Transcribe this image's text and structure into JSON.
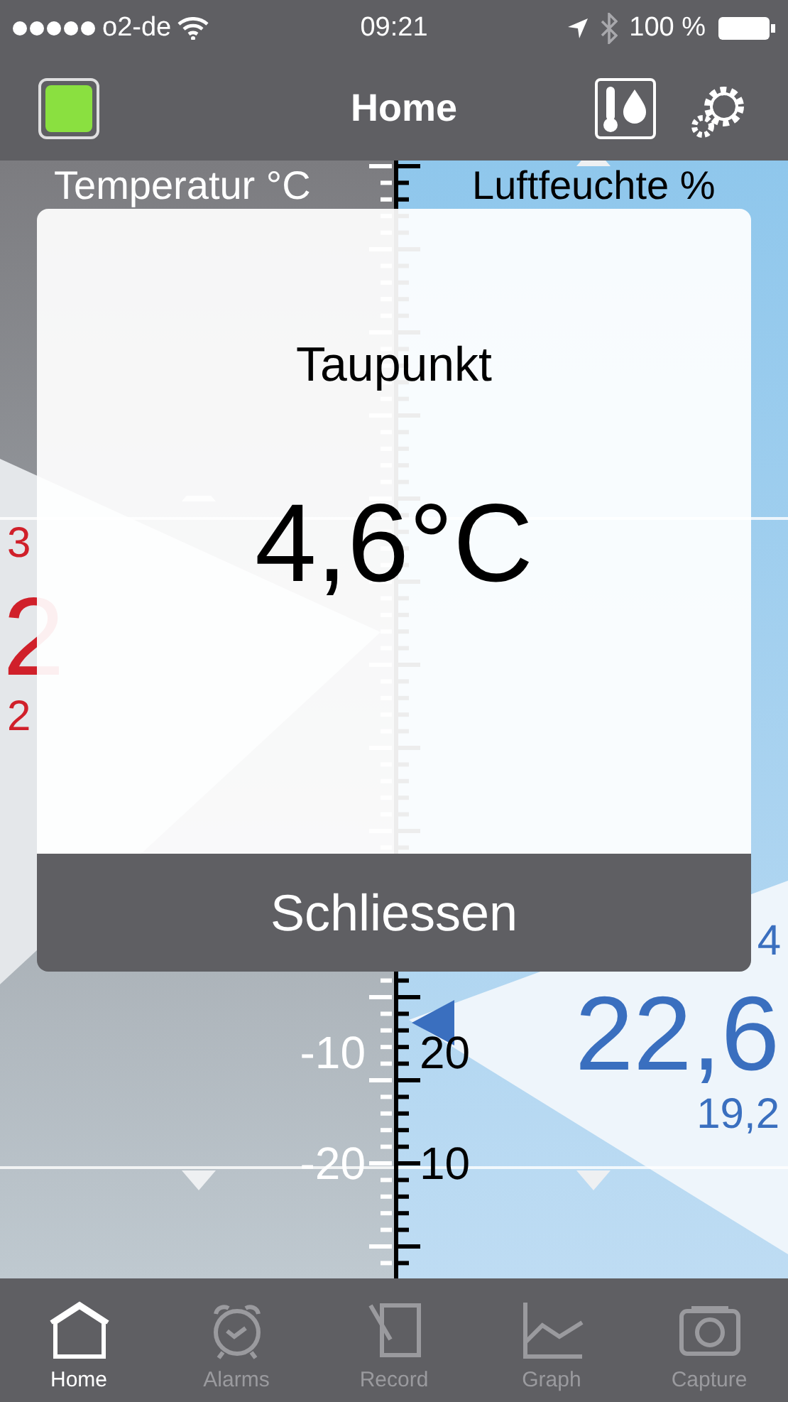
{
  "status_bar": {
    "carrier": "o2-de",
    "time": "09:21",
    "battery": "100 %"
  },
  "nav_bar": {
    "title": "Home"
  },
  "gauges": [
    {
      "kind": "temperature",
      "title": "Temperatur °C",
      "max": "3",
      "current": "2",
      "min": "2",
      "scale_labels": [
        "-10",
        "-20"
      ]
    },
    {
      "kind": "humidity",
      "title": "Luftfeuchte %",
      "max": "4",
      "current": "22,6",
      "min": "19,2",
      "scale_labels": [
        "20",
        "10"
      ]
    }
  ],
  "dialog": {
    "title": "Taupunkt",
    "value": "4,6°C",
    "button": "Schliessen"
  },
  "tab_bar": [
    {
      "label": "Home",
      "selected": true
    },
    {
      "label": "Alarms",
      "selected": false
    },
    {
      "label": "Record",
      "selected": false
    },
    {
      "label": "Graph",
      "selected": false
    },
    {
      "label": "Capture",
      "selected": false
    }
  ]
}
